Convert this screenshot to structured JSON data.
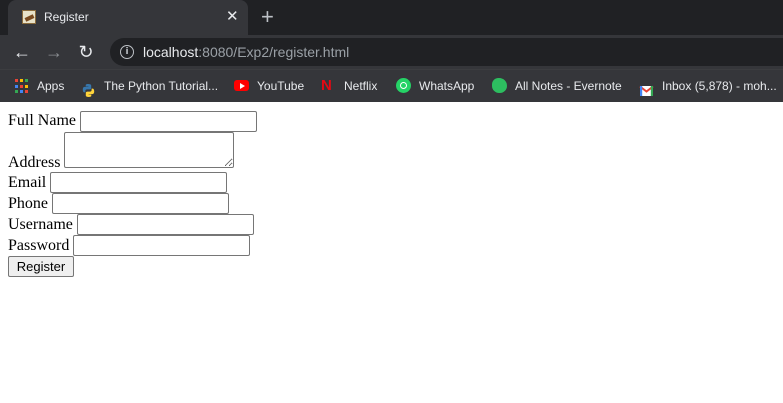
{
  "browser": {
    "tab": {
      "title": "Register",
      "close_glyph": "✕"
    },
    "new_tab_glyph": "+",
    "nav": {
      "back": "←",
      "forward": "→",
      "reload": "↻"
    },
    "address": {
      "host": "localhost",
      "rest": ":8080/Exp2/register.html",
      "info_glyph": "i"
    },
    "bookmarks": [
      {
        "label": "Apps",
        "icon": "apps-grid-icon"
      },
      {
        "label": "The Python Tutorial...",
        "icon": "python-icon"
      },
      {
        "label": "YouTube",
        "icon": "youtube-icon"
      },
      {
        "label": "Netflix",
        "icon": "netflix-icon",
        "glyph": "N"
      },
      {
        "label": "WhatsApp",
        "icon": "whatsapp-icon"
      },
      {
        "label": "All Notes - Evernote",
        "icon": "evernote-icon"
      },
      {
        "label": "Inbox (5,878) - moh...",
        "icon": "gmail-icon"
      }
    ]
  },
  "form": {
    "fields": [
      {
        "label": "Full Name",
        "value": ""
      },
      {
        "label": "Address",
        "value": ""
      },
      {
        "label": "Email",
        "value": ""
      },
      {
        "label": "Phone",
        "value": ""
      },
      {
        "label": "Username",
        "value": ""
      },
      {
        "label": "Password",
        "value": ""
      }
    ],
    "submit_label": "Register"
  },
  "colors": {
    "tab_bar": "#202124",
    "toolbar": "#35363a",
    "page_bg": "#ffffff",
    "input_border": "#767676",
    "button_bg": "#efefef"
  }
}
